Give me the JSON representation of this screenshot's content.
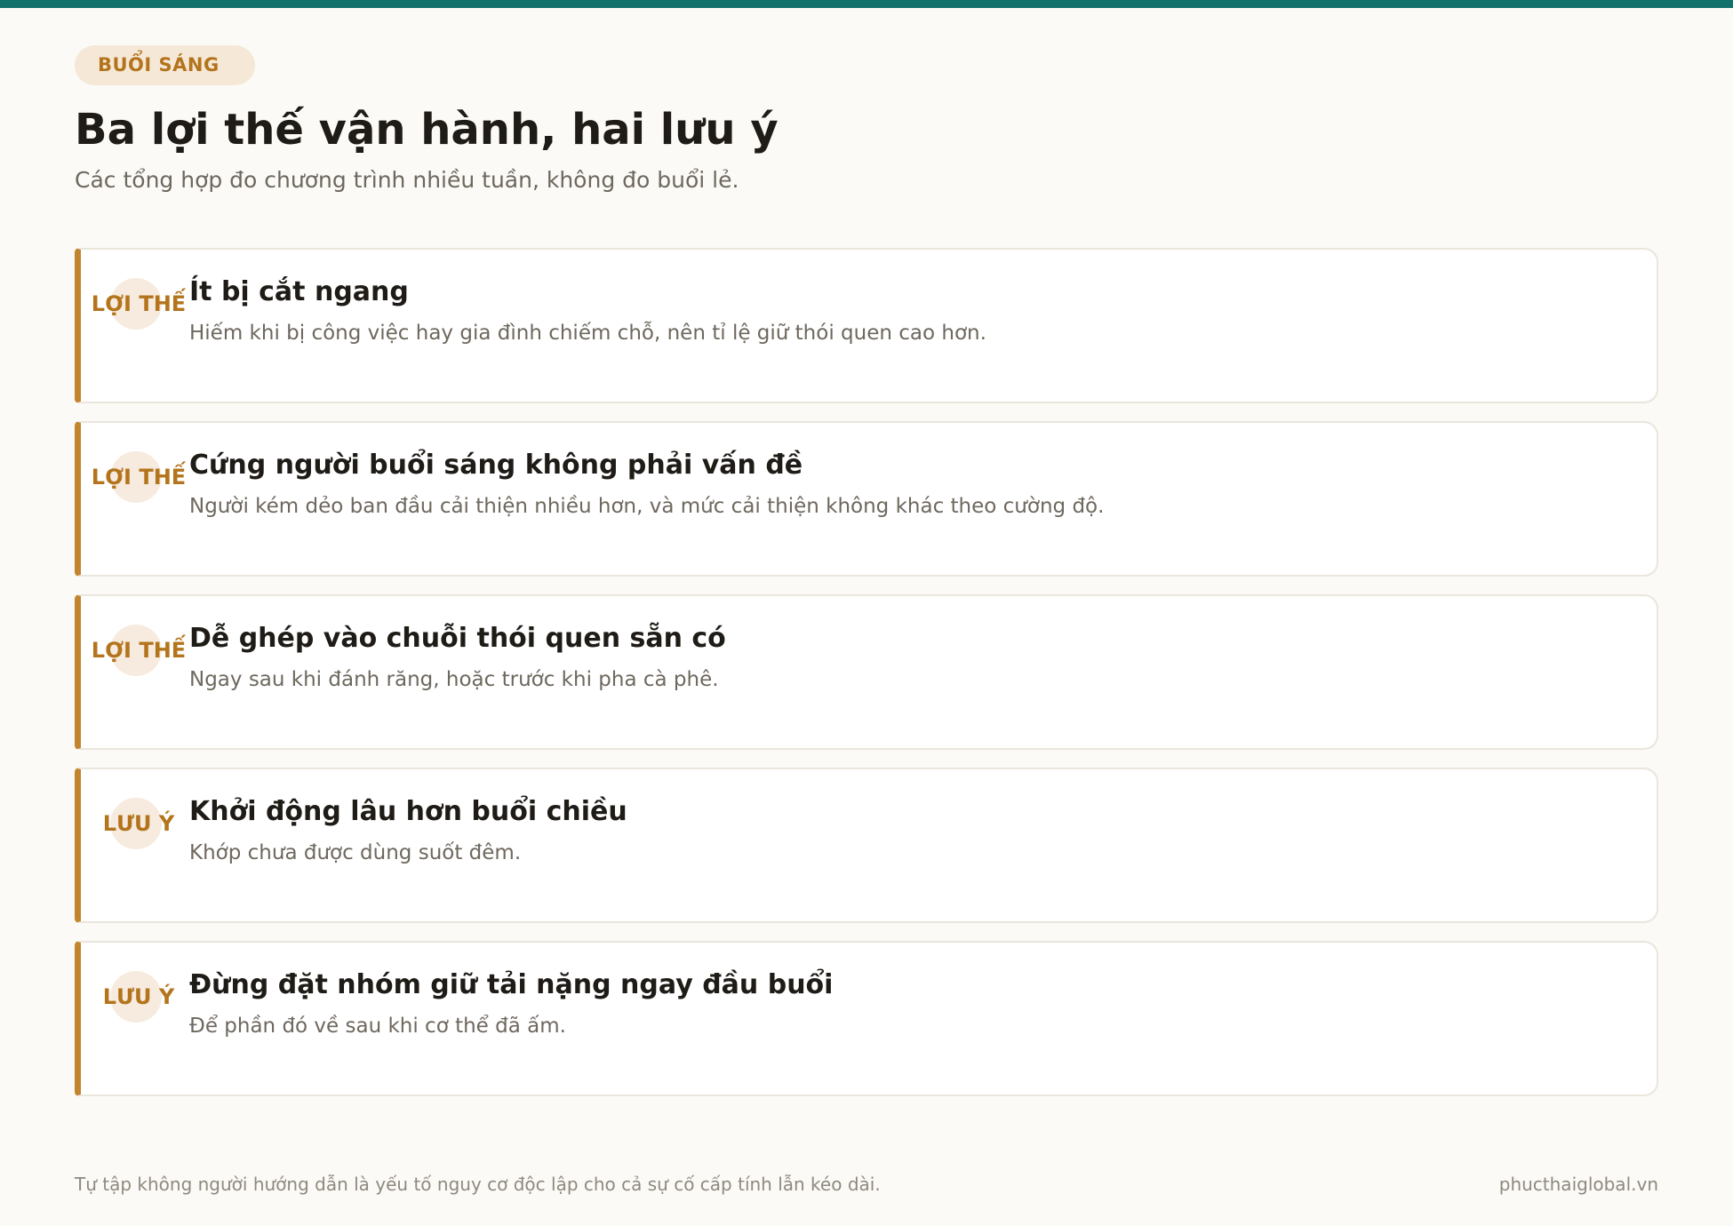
{
  "header": {
    "tag": "BUỔI SÁNG",
    "title": "Ba lợi thế vận hành, hai lưu ý",
    "subtitle": "Các tổng hợp đo chương trình nhiều tuần, không đo buổi lẻ."
  },
  "cards": [
    {
      "badge": "LỢI THẾ",
      "title": "Ít bị cắt ngang",
      "description": "Hiếm khi bị công việc hay gia đình chiếm chỗ, nên tỉ lệ giữ thói quen cao hơn."
    },
    {
      "badge": "LỢI THẾ",
      "title": "Cứng người buổi sáng không phải vấn đề",
      "description": "Người kém dẻo ban đầu cải thiện nhiều hơn, và mức cải thiện không khác theo cường độ."
    },
    {
      "badge": "LỢI THẾ",
      "title": "Dễ ghép vào chuỗi thói quen sẵn có",
      "description": "Ngay sau khi đánh răng, hoặc trước khi pha cà phê."
    },
    {
      "badge": "LƯU Ý",
      "title": "Khởi động lâu hơn buổi chiều",
      "description": "Khớp chưa được dùng suốt đêm."
    },
    {
      "badge": "LƯU Ý",
      "title": "Đừng đặt nhóm giữ tải nặng ngay đầu buổi",
      "description": "Để phần đó về sau khi cơ thể đã ấm."
    }
  ],
  "footer": {
    "note": "Tự tập không người hướng dẫn là yếu tố nguy cơ độc lập cho cả sự cố cấp tính lẫn kéo dài.",
    "site": "phucthaiglobal.vn"
  },
  "colors": {
    "accent_teal": "#13716b",
    "accent_amber": "#c2852f",
    "badge_bg": "#f6ebde",
    "page_bg": "#fbfaf7"
  }
}
